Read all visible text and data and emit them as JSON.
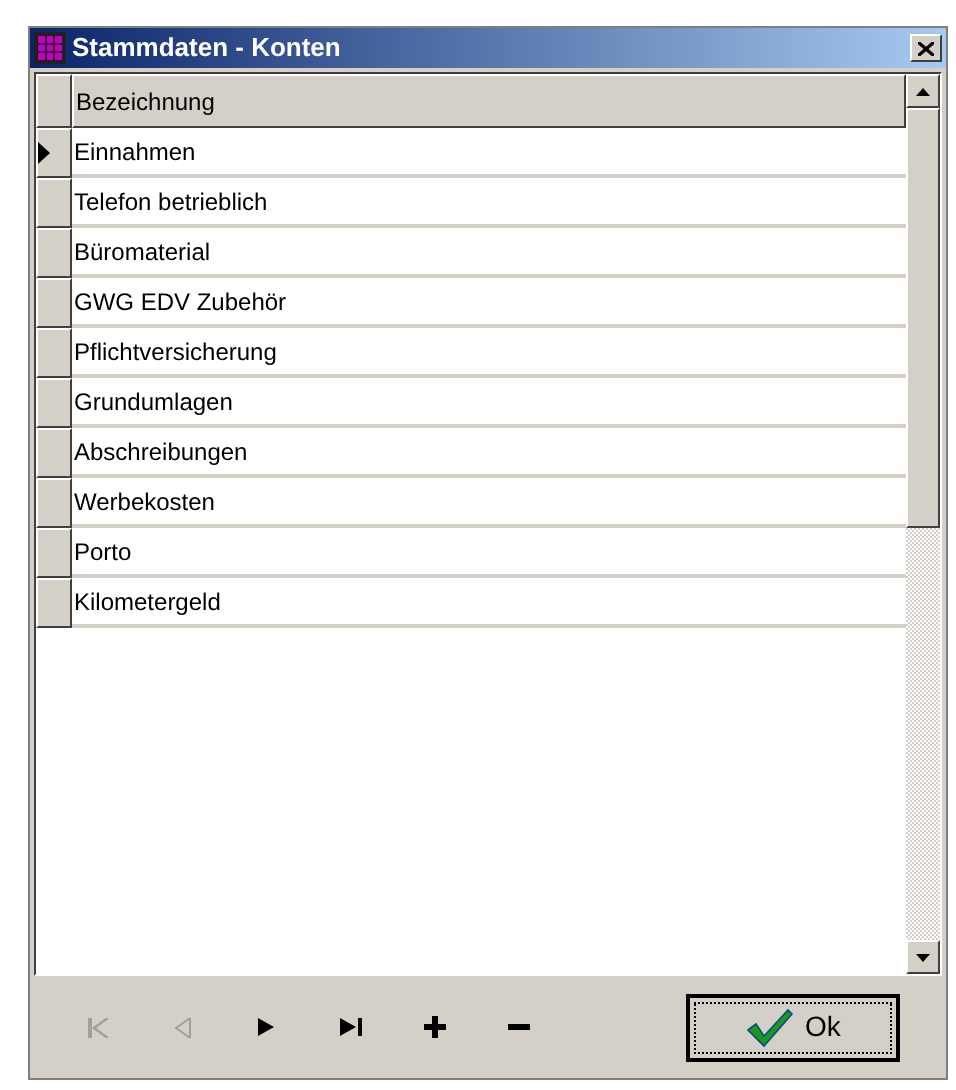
{
  "window": {
    "title": "Stammdaten - Konten"
  },
  "table": {
    "columns": [
      "Bezeichnung"
    ],
    "rows": [
      {
        "cell": "Einnahmen",
        "selected": true
      },
      {
        "cell": "Telefon betrieblich",
        "selected": false
      },
      {
        "cell": "Büromaterial",
        "selected": false
      },
      {
        "cell": "GWG EDV Zubehör",
        "selected": false
      },
      {
        "cell": "Pflichtversicherung",
        "selected": false
      },
      {
        "cell": "Grundumlagen",
        "selected": false
      },
      {
        "cell": "Abschreibungen",
        "selected": false
      },
      {
        "cell": "Werbekosten",
        "selected": false
      },
      {
        "cell": "Porto",
        "selected": false
      },
      {
        "cell": "Kilometergeld",
        "selected": false
      }
    ]
  },
  "navigator": [
    {
      "kind": "first",
      "disabled": true
    },
    {
      "kind": "prior",
      "disabled": true
    },
    {
      "kind": "next",
      "disabled": false
    },
    {
      "kind": "last",
      "disabled": false
    },
    {
      "kind": "insert",
      "disabled": false
    },
    {
      "kind": "delete",
      "disabled": false
    }
  ],
  "ok_button": {
    "label": "Ok"
  }
}
